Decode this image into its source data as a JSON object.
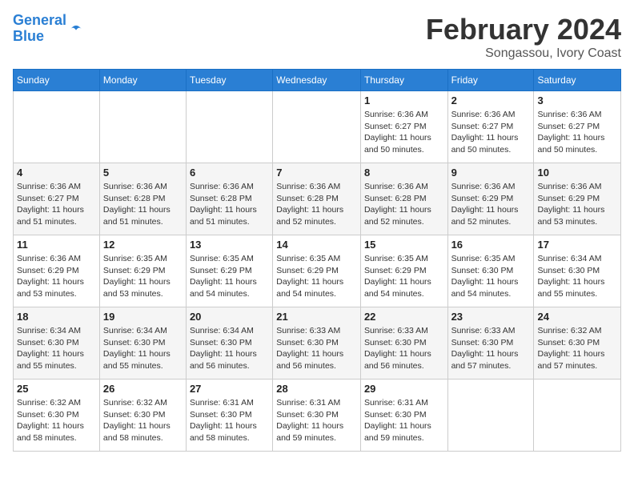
{
  "header": {
    "logo_line1": "General",
    "logo_line2": "Blue",
    "month_title": "February 2024",
    "subtitle": "Songassou, Ivory Coast"
  },
  "weekdays": [
    "Sunday",
    "Monday",
    "Tuesday",
    "Wednesday",
    "Thursday",
    "Friday",
    "Saturday"
  ],
  "weeks": [
    [
      {
        "day": "",
        "info": ""
      },
      {
        "day": "",
        "info": ""
      },
      {
        "day": "",
        "info": ""
      },
      {
        "day": "",
        "info": ""
      },
      {
        "day": "1",
        "info": "Sunrise: 6:36 AM\nSunset: 6:27 PM\nDaylight: 11 hours\nand 50 minutes."
      },
      {
        "day": "2",
        "info": "Sunrise: 6:36 AM\nSunset: 6:27 PM\nDaylight: 11 hours\nand 50 minutes."
      },
      {
        "day": "3",
        "info": "Sunrise: 6:36 AM\nSunset: 6:27 PM\nDaylight: 11 hours\nand 50 minutes."
      }
    ],
    [
      {
        "day": "4",
        "info": "Sunrise: 6:36 AM\nSunset: 6:27 PM\nDaylight: 11 hours\nand 51 minutes."
      },
      {
        "day": "5",
        "info": "Sunrise: 6:36 AM\nSunset: 6:28 PM\nDaylight: 11 hours\nand 51 minutes."
      },
      {
        "day": "6",
        "info": "Sunrise: 6:36 AM\nSunset: 6:28 PM\nDaylight: 11 hours\nand 51 minutes."
      },
      {
        "day": "7",
        "info": "Sunrise: 6:36 AM\nSunset: 6:28 PM\nDaylight: 11 hours\nand 52 minutes."
      },
      {
        "day": "8",
        "info": "Sunrise: 6:36 AM\nSunset: 6:28 PM\nDaylight: 11 hours\nand 52 minutes."
      },
      {
        "day": "9",
        "info": "Sunrise: 6:36 AM\nSunset: 6:29 PM\nDaylight: 11 hours\nand 52 minutes."
      },
      {
        "day": "10",
        "info": "Sunrise: 6:36 AM\nSunset: 6:29 PM\nDaylight: 11 hours\nand 53 minutes."
      }
    ],
    [
      {
        "day": "11",
        "info": "Sunrise: 6:36 AM\nSunset: 6:29 PM\nDaylight: 11 hours\nand 53 minutes."
      },
      {
        "day": "12",
        "info": "Sunrise: 6:35 AM\nSunset: 6:29 PM\nDaylight: 11 hours\nand 53 minutes."
      },
      {
        "day": "13",
        "info": "Sunrise: 6:35 AM\nSunset: 6:29 PM\nDaylight: 11 hours\nand 54 minutes."
      },
      {
        "day": "14",
        "info": "Sunrise: 6:35 AM\nSunset: 6:29 PM\nDaylight: 11 hours\nand 54 minutes."
      },
      {
        "day": "15",
        "info": "Sunrise: 6:35 AM\nSunset: 6:29 PM\nDaylight: 11 hours\nand 54 minutes."
      },
      {
        "day": "16",
        "info": "Sunrise: 6:35 AM\nSunset: 6:30 PM\nDaylight: 11 hours\nand 54 minutes."
      },
      {
        "day": "17",
        "info": "Sunrise: 6:34 AM\nSunset: 6:30 PM\nDaylight: 11 hours\nand 55 minutes."
      }
    ],
    [
      {
        "day": "18",
        "info": "Sunrise: 6:34 AM\nSunset: 6:30 PM\nDaylight: 11 hours\nand 55 minutes."
      },
      {
        "day": "19",
        "info": "Sunrise: 6:34 AM\nSunset: 6:30 PM\nDaylight: 11 hours\nand 55 minutes."
      },
      {
        "day": "20",
        "info": "Sunrise: 6:34 AM\nSunset: 6:30 PM\nDaylight: 11 hours\nand 56 minutes."
      },
      {
        "day": "21",
        "info": "Sunrise: 6:33 AM\nSunset: 6:30 PM\nDaylight: 11 hours\nand 56 minutes."
      },
      {
        "day": "22",
        "info": "Sunrise: 6:33 AM\nSunset: 6:30 PM\nDaylight: 11 hours\nand 56 minutes."
      },
      {
        "day": "23",
        "info": "Sunrise: 6:33 AM\nSunset: 6:30 PM\nDaylight: 11 hours\nand 57 minutes."
      },
      {
        "day": "24",
        "info": "Sunrise: 6:32 AM\nSunset: 6:30 PM\nDaylight: 11 hours\nand 57 minutes."
      }
    ],
    [
      {
        "day": "25",
        "info": "Sunrise: 6:32 AM\nSunset: 6:30 PM\nDaylight: 11 hours\nand 58 minutes."
      },
      {
        "day": "26",
        "info": "Sunrise: 6:32 AM\nSunset: 6:30 PM\nDaylight: 11 hours\nand 58 minutes."
      },
      {
        "day": "27",
        "info": "Sunrise: 6:31 AM\nSunset: 6:30 PM\nDaylight: 11 hours\nand 58 minutes."
      },
      {
        "day": "28",
        "info": "Sunrise: 6:31 AM\nSunset: 6:30 PM\nDaylight: 11 hours\nand 59 minutes."
      },
      {
        "day": "29",
        "info": "Sunrise: 6:31 AM\nSunset: 6:30 PM\nDaylight: 11 hours\nand 59 minutes."
      },
      {
        "day": "",
        "info": ""
      },
      {
        "day": "",
        "info": ""
      }
    ]
  ]
}
